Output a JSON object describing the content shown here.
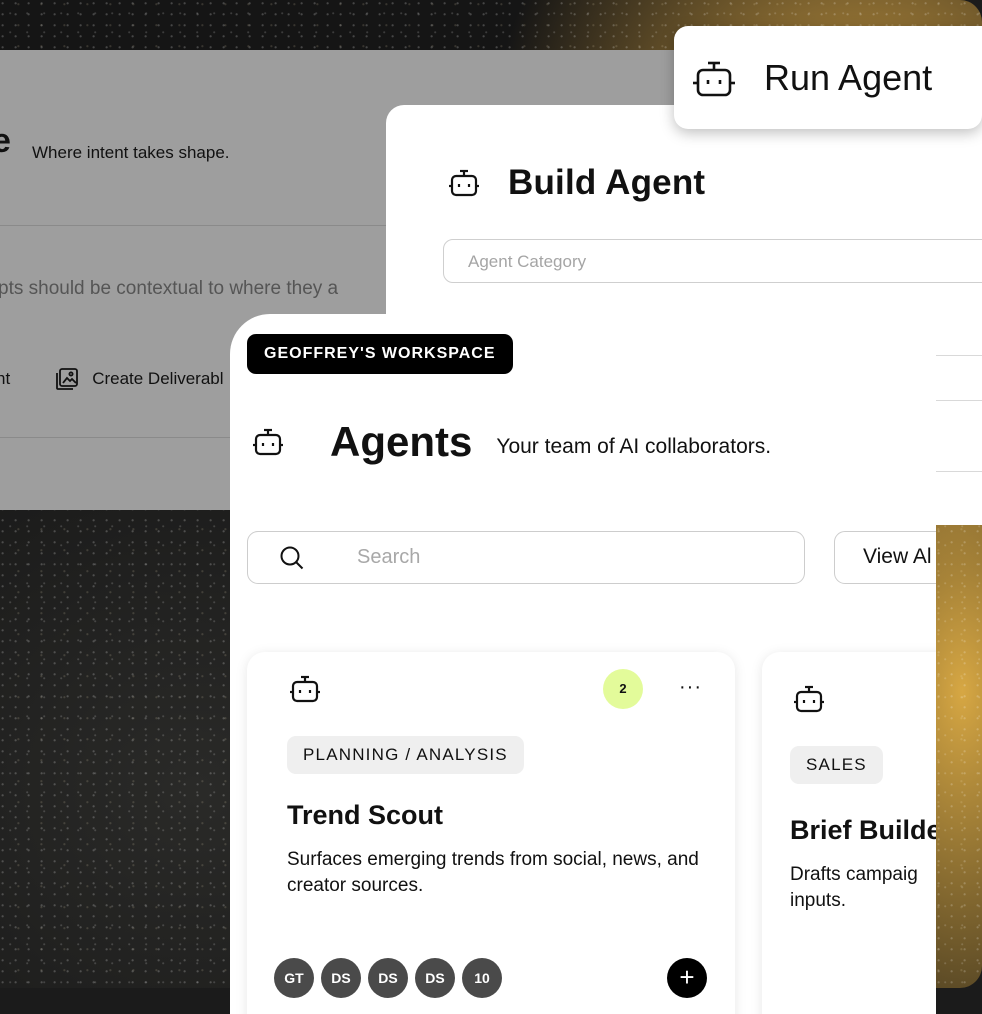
{
  "background_panel": {
    "title_fragment": "e",
    "tagline": "Where intent takes shape.",
    "hint_text": "pts should be contextual to where they a",
    "action_1": "nt",
    "action_2": "Create Deliverabl"
  },
  "build_panel": {
    "title": "Build Agent",
    "category_placeholder": "Agent Category"
  },
  "run_chip": {
    "label": "Run Agent"
  },
  "agents_panel": {
    "workspace_badge": "GEOFFREY'S WORKSPACE",
    "title": "Agents",
    "subtitle": "Your team of AI collaborators.",
    "search_placeholder": "Search",
    "view_all_label": "View Al",
    "cards": [
      {
        "count": "2",
        "more": "···",
        "tag": "PLANNING / ANALYSIS",
        "name": "Trend Scout",
        "description": "Surfaces emerging trends from social, news, and creator sources.",
        "avatars": [
          "GT",
          "DS",
          "DS",
          "DS",
          "10"
        ],
        "add": "+"
      },
      {
        "tag": "SALES",
        "name": "Brief Builde",
        "description_line1": "Drafts campaig",
        "description_line2": "inputs."
      }
    ]
  },
  "colors": {
    "accent_badge": "#e3fb9a",
    "avatar_bg": "#4a4a4a",
    "overlay_gray": "#9e9e9e"
  },
  "icons": [
    "robot-icon",
    "search-icon",
    "chevron-down-icon",
    "image-add-icon",
    "more-icon",
    "plus-icon"
  ]
}
